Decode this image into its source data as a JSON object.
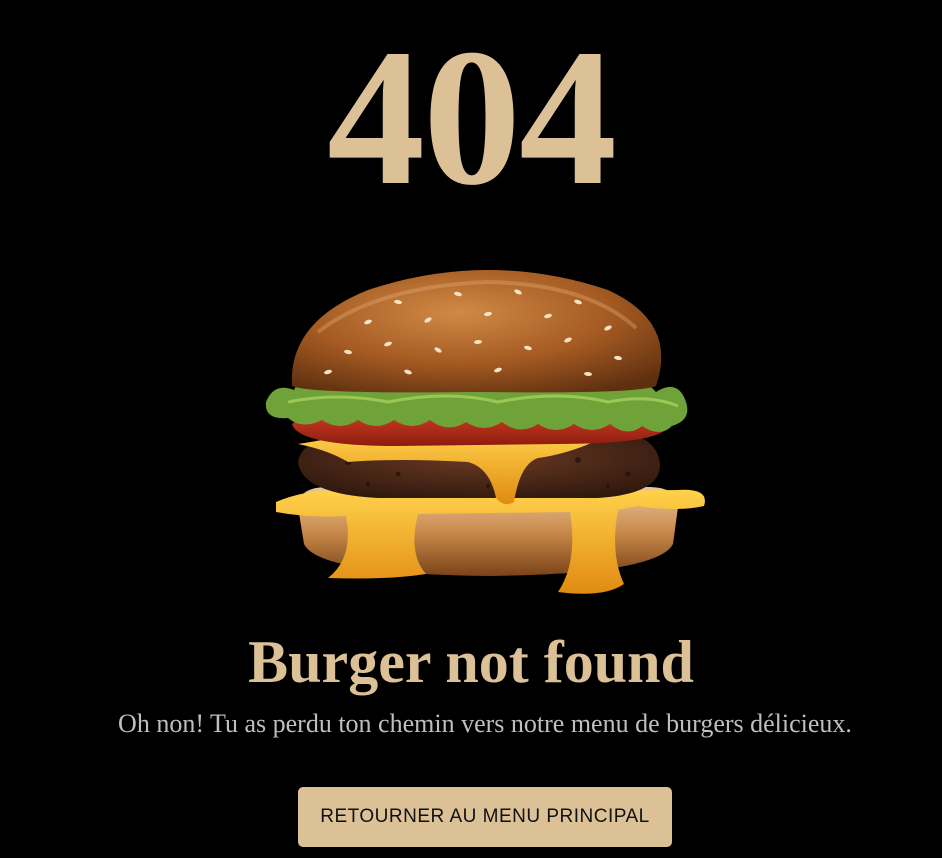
{
  "error": {
    "code": "404"
  },
  "hero_image": {
    "description_icon": "burger-image"
  },
  "message": {
    "title": "Burger not found",
    "subtitle": "Oh non! Tu as perdu ton chemin vers notre menu de burgers délicieux."
  },
  "actions": {
    "home_button_label": "RETOURNER AU MENU PRINCIPAL"
  },
  "colors": {
    "background": "#000000",
    "accent": "#dcc196",
    "subtitle_text": "#bfbfbf",
    "button_text": "#111111"
  }
}
